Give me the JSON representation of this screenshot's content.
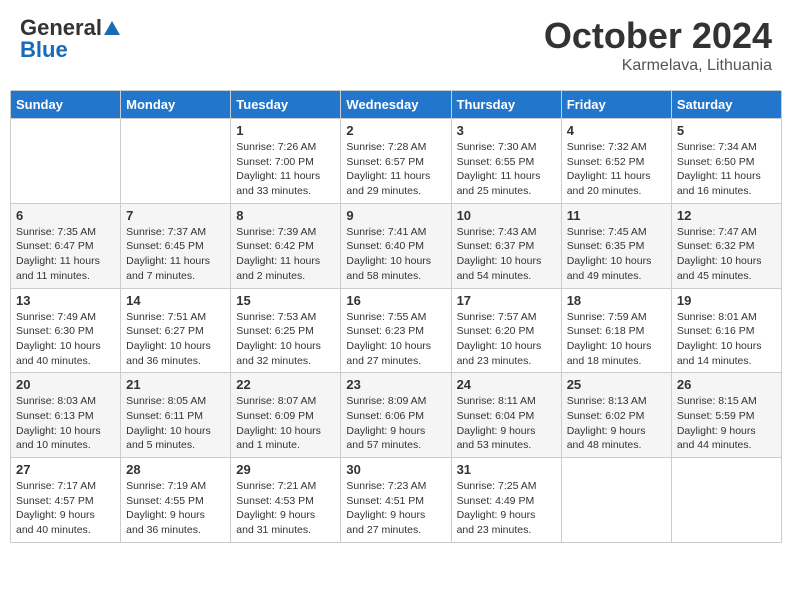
{
  "header": {
    "logo_general": "General",
    "logo_blue": "Blue",
    "month_title": "October 2024",
    "location": "Karmelava, Lithuania"
  },
  "days_of_week": [
    "Sunday",
    "Monday",
    "Tuesday",
    "Wednesday",
    "Thursday",
    "Friday",
    "Saturday"
  ],
  "weeks": [
    [
      {
        "day": "",
        "sunrise": "",
        "sunset": "",
        "daylight": ""
      },
      {
        "day": "",
        "sunrise": "",
        "sunset": "",
        "daylight": ""
      },
      {
        "day": "1",
        "sunrise": "Sunrise: 7:26 AM",
        "sunset": "Sunset: 7:00 PM",
        "daylight": "Daylight: 11 hours and 33 minutes."
      },
      {
        "day": "2",
        "sunrise": "Sunrise: 7:28 AM",
        "sunset": "Sunset: 6:57 PM",
        "daylight": "Daylight: 11 hours and 29 minutes."
      },
      {
        "day": "3",
        "sunrise": "Sunrise: 7:30 AM",
        "sunset": "Sunset: 6:55 PM",
        "daylight": "Daylight: 11 hours and 25 minutes."
      },
      {
        "day": "4",
        "sunrise": "Sunrise: 7:32 AM",
        "sunset": "Sunset: 6:52 PM",
        "daylight": "Daylight: 11 hours and 20 minutes."
      },
      {
        "day": "5",
        "sunrise": "Sunrise: 7:34 AM",
        "sunset": "Sunset: 6:50 PM",
        "daylight": "Daylight: 11 hours and 16 minutes."
      }
    ],
    [
      {
        "day": "6",
        "sunrise": "Sunrise: 7:35 AM",
        "sunset": "Sunset: 6:47 PM",
        "daylight": "Daylight: 11 hours and 11 minutes."
      },
      {
        "day": "7",
        "sunrise": "Sunrise: 7:37 AM",
        "sunset": "Sunset: 6:45 PM",
        "daylight": "Daylight: 11 hours and 7 minutes."
      },
      {
        "day": "8",
        "sunrise": "Sunrise: 7:39 AM",
        "sunset": "Sunset: 6:42 PM",
        "daylight": "Daylight: 11 hours and 2 minutes."
      },
      {
        "day": "9",
        "sunrise": "Sunrise: 7:41 AM",
        "sunset": "Sunset: 6:40 PM",
        "daylight": "Daylight: 10 hours and 58 minutes."
      },
      {
        "day": "10",
        "sunrise": "Sunrise: 7:43 AM",
        "sunset": "Sunset: 6:37 PM",
        "daylight": "Daylight: 10 hours and 54 minutes."
      },
      {
        "day": "11",
        "sunrise": "Sunrise: 7:45 AM",
        "sunset": "Sunset: 6:35 PM",
        "daylight": "Daylight: 10 hours and 49 minutes."
      },
      {
        "day": "12",
        "sunrise": "Sunrise: 7:47 AM",
        "sunset": "Sunset: 6:32 PM",
        "daylight": "Daylight: 10 hours and 45 minutes."
      }
    ],
    [
      {
        "day": "13",
        "sunrise": "Sunrise: 7:49 AM",
        "sunset": "Sunset: 6:30 PM",
        "daylight": "Daylight: 10 hours and 40 minutes."
      },
      {
        "day": "14",
        "sunrise": "Sunrise: 7:51 AM",
        "sunset": "Sunset: 6:27 PM",
        "daylight": "Daylight: 10 hours and 36 minutes."
      },
      {
        "day": "15",
        "sunrise": "Sunrise: 7:53 AM",
        "sunset": "Sunset: 6:25 PM",
        "daylight": "Daylight: 10 hours and 32 minutes."
      },
      {
        "day": "16",
        "sunrise": "Sunrise: 7:55 AM",
        "sunset": "Sunset: 6:23 PM",
        "daylight": "Daylight: 10 hours and 27 minutes."
      },
      {
        "day": "17",
        "sunrise": "Sunrise: 7:57 AM",
        "sunset": "Sunset: 6:20 PM",
        "daylight": "Daylight: 10 hours and 23 minutes."
      },
      {
        "day": "18",
        "sunrise": "Sunrise: 7:59 AM",
        "sunset": "Sunset: 6:18 PM",
        "daylight": "Daylight: 10 hours and 18 minutes."
      },
      {
        "day": "19",
        "sunrise": "Sunrise: 8:01 AM",
        "sunset": "Sunset: 6:16 PM",
        "daylight": "Daylight: 10 hours and 14 minutes."
      }
    ],
    [
      {
        "day": "20",
        "sunrise": "Sunrise: 8:03 AM",
        "sunset": "Sunset: 6:13 PM",
        "daylight": "Daylight: 10 hours and 10 minutes."
      },
      {
        "day": "21",
        "sunrise": "Sunrise: 8:05 AM",
        "sunset": "Sunset: 6:11 PM",
        "daylight": "Daylight: 10 hours and 5 minutes."
      },
      {
        "day": "22",
        "sunrise": "Sunrise: 8:07 AM",
        "sunset": "Sunset: 6:09 PM",
        "daylight": "Daylight: 10 hours and 1 minute."
      },
      {
        "day": "23",
        "sunrise": "Sunrise: 8:09 AM",
        "sunset": "Sunset: 6:06 PM",
        "daylight": "Daylight: 9 hours and 57 minutes."
      },
      {
        "day": "24",
        "sunrise": "Sunrise: 8:11 AM",
        "sunset": "Sunset: 6:04 PM",
        "daylight": "Daylight: 9 hours and 53 minutes."
      },
      {
        "day": "25",
        "sunrise": "Sunrise: 8:13 AM",
        "sunset": "Sunset: 6:02 PM",
        "daylight": "Daylight: 9 hours and 48 minutes."
      },
      {
        "day": "26",
        "sunrise": "Sunrise: 8:15 AM",
        "sunset": "Sunset: 5:59 PM",
        "daylight": "Daylight: 9 hours and 44 minutes."
      }
    ],
    [
      {
        "day": "27",
        "sunrise": "Sunrise: 7:17 AM",
        "sunset": "Sunset: 4:57 PM",
        "daylight": "Daylight: 9 hours and 40 minutes."
      },
      {
        "day": "28",
        "sunrise": "Sunrise: 7:19 AM",
        "sunset": "Sunset: 4:55 PM",
        "daylight": "Daylight: 9 hours and 36 minutes."
      },
      {
        "day": "29",
        "sunrise": "Sunrise: 7:21 AM",
        "sunset": "Sunset: 4:53 PM",
        "daylight": "Daylight: 9 hours and 31 minutes."
      },
      {
        "day": "30",
        "sunrise": "Sunrise: 7:23 AM",
        "sunset": "Sunset: 4:51 PM",
        "daylight": "Daylight: 9 hours and 27 minutes."
      },
      {
        "day": "31",
        "sunrise": "Sunrise: 7:25 AM",
        "sunset": "Sunset: 4:49 PM",
        "daylight": "Daylight: 9 hours and 23 minutes."
      },
      {
        "day": "",
        "sunrise": "",
        "sunset": "",
        "daylight": ""
      },
      {
        "day": "",
        "sunrise": "",
        "sunset": "",
        "daylight": ""
      }
    ]
  ]
}
